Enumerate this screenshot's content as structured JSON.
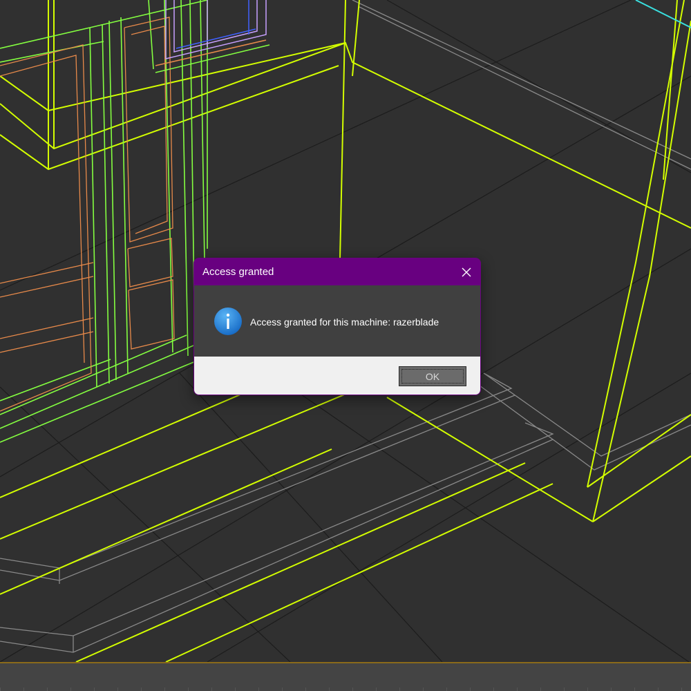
{
  "dialog": {
    "title": "Access granted",
    "message": "Access granted for this machine: razerblade",
    "ok_label": "OK",
    "close_icon": "close-icon",
    "info_icon": "info-icon"
  },
  "viewport": {
    "description_icon": "wireframe-3d-viewport"
  },
  "colors": {
    "titlebar": "#680080",
    "viewport_bg": "#303030",
    "wire_yellow": "#d4ff00",
    "wire_green": "#84ff40",
    "wire_orange": "#e88a4a",
    "wire_grey": "#8a8a8a",
    "info_blue": "#1a7fd6"
  }
}
